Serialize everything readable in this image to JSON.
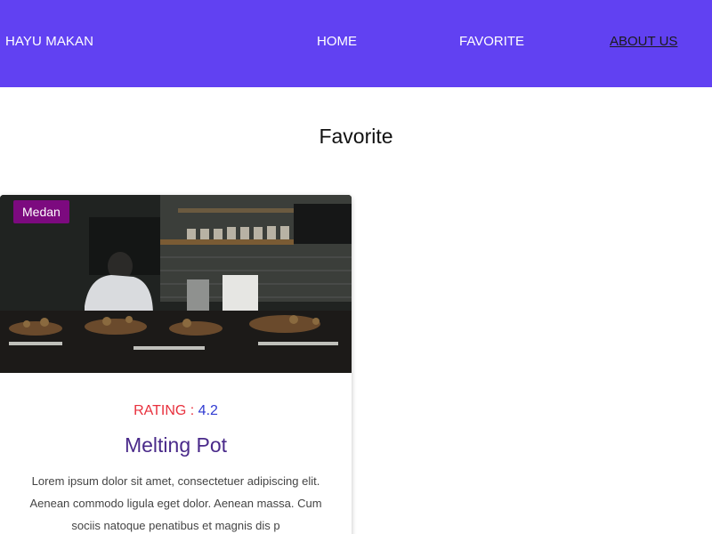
{
  "nav": {
    "brand": "HAYU MAKAN",
    "links": [
      {
        "label": "HOME"
      },
      {
        "label": "FAVORITE"
      },
      {
        "label": "ABOUT US"
      }
    ]
  },
  "page": {
    "title": "Favorite"
  },
  "card": {
    "city": "Medan",
    "rating_label": "RATING : ",
    "rating_value": "4.2",
    "name": "Melting Pot",
    "description": "Lorem ipsum dolor sit amet, consectetuer adipiscing elit. Aenean commodo ligula eget dolor. Aenean massa. Cum sociis natoque penatibus et magnis dis p"
  },
  "colors": {
    "nav_background": "#6141f2",
    "badge_background": "#7c0a7f",
    "rating_label": "#e8303d",
    "rating_value": "#2f3ad1",
    "restaurant_name": "#4a2a8a"
  }
}
